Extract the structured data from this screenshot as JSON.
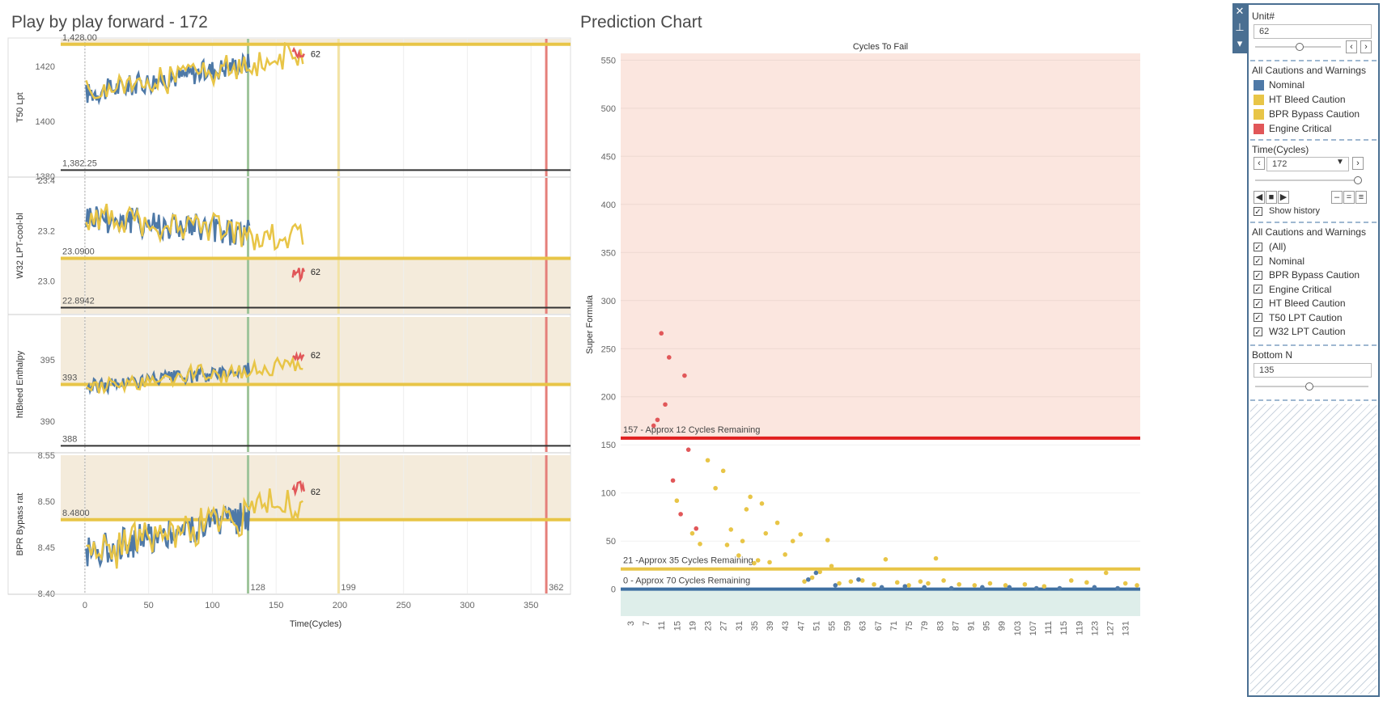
{
  "left_title": "Play by play forward - 172",
  "right_title": "Prediction Chart",
  "colors": {
    "nominal": "#4e79a7",
    "caution": "#e8c547",
    "critical": "#e15759",
    "band": "#f4ebdb",
    "crit_band": "#fbe6df",
    "low_band": "#deeeea",
    "green_line": "#9fc59b",
    "red_line": "#e57f7a",
    "pale_yellow": "#f3e3a4",
    "crit_rule": "#e02020",
    "nominal_rule": "#3e6fa1"
  },
  "left_chart": {
    "x_axis_title": "Time(Cycles)",
    "x_ticks": [
      "0",
      "50",
      "100",
      "150",
      "200",
      "250",
      "300",
      "350"
    ],
    "ref_lines": [
      {
        "x": 128,
        "label": "128",
        "color": "green"
      },
      {
        "x": 199,
        "label": "199",
        "color": "yellow"
      },
      {
        "x": 362,
        "label": "362",
        "color": "red"
      }
    ],
    "unit_label": "62",
    "panels": [
      {
        "ylabel": "T50 Lpt",
        "ymin": 1380,
        "ymax": 1430,
        "ticks": [
          "1380",
          "1400",
          "1420"
        ],
        "upper": 1428.0,
        "upper_label": "1,428.00",
        "lower": 1382.25,
        "lower_label": "1,382.25",
        "band": "above",
        "base": 1410,
        "amp": 4,
        "trend": 14,
        "end": 1425,
        "drop_line": false
      },
      {
        "ylabel": "W32 LPT-cool-bl",
        "ymin": 22.87,
        "ymax": 23.41,
        "ticks": [
          "23.0",
          "23.2",
          "23.4"
        ],
        "upper": 23.09,
        "upper_label": "23.0900",
        "lower": 22.8942,
        "lower_label": "22.8942",
        "band": "below",
        "base": 23.26,
        "amp": 0.06,
        "trend": -0.09,
        "end": 23.03,
        "drop_line": false
      },
      {
        "ylabel": "htBleed Enthalpy",
        "ymin": 387.5,
        "ymax": 398.5,
        "ticks": [
          "390",
          "395"
        ],
        "upper": 393,
        "upper_label": "393",
        "lower": 388,
        "lower_label": "388",
        "band": "above",
        "base": 392.8,
        "amp": 0.6,
        "trend": 1.7,
        "end": 395.2,
        "drop_line": true
      },
      {
        "ylabel": "BPR Bypass rat",
        "ymin": 8.4,
        "ymax": 8.55,
        "ticks": [
          "8.40",
          "8.45",
          "8.50",
          "8.55"
        ],
        "upper": 8.48,
        "upper_label": "8.4800",
        "lower": null,
        "lower_label": "",
        "band": "above",
        "base": 8.445,
        "amp": 0.018,
        "trend": 0.05,
        "end": 8.515,
        "drop_line": false
      }
    ]
  },
  "right_chart": {
    "top_title": "Cycles To Fail",
    "ylabel": "Super Formula",
    "ymin": -28,
    "ymax": 557,
    "y_ticks": [
      "0",
      "50",
      "100",
      "150",
      "200",
      "250",
      "300",
      "350",
      "400",
      "450",
      "500",
      "550"
    ],
    "x_ticks": [
      "3",
      "7",
      "11",
      "15",
      "19",
      "23",
      "27",
      "31",
      "35",
      "39",
      "43",
      "47",
      "51",
      "55",
      "59",
      "63",
      "67",
      "71",
      "75",
      "79",
      "83",
      "87",
      "91",
      "95",
      "99",
      "103",
      "107",
      "111",
      "115",
      "119",
      "123",
      "127",
      "131"
    ],
    "thresholds": [
      {
        "value": 157,
        "label": "157 - Approx 12 Cycles Remaining",
        "color": "critical_rule"
      },
      {
        "value": 21,
        "label": "21 -Approx 35 Cycles Remaining",
        "color": "caution"
      },
      {
        "value": 0,
        "label": "0 - Approx 70 Cycles Remaining",
        "color": "nominal_rule"
      }
    ],
    "points": [
      {
        "x": 10,
        "y": 176,
        "s": "critical"
      },
      {
        "x": 11,
        "y": 266,
        "s": "critical"
      },
      {
        "x": 12,
        "y": 192,
        "s": "critical"
      },
      {
        "x": 13,
        "y": 241,
        "s": "critical"
      },
      {
        "x": 14,
        "y": 113,
        "s": "critical"
      },
      {
        "x": 16,
        "y": 78,
        "s": "critical"
      },
      {
        "x": 17,
        "y": 222,
        "s": "critical"
      },
      {
        "x": 18,
        "y": 145,
        "s": "critical"
      },
      {
        "x": 20,
        "y": 63,
        "s": "critical"
      },
      {
        "x": 9,
        "y": 170,
        "s": "critical"
      },
      {
        "x": 15,
        "y": 92,
        "s": "caution"
      },
      {
        "x": 19,
        "y": 58,
        "s": "caution"
      },
      {
        "x": 21,
        "y": 47,
        "s": "caution"
      },
      {
        "x": 23,
        "y": 134,
        "s": "caution"
      },
      {
        "x": 25,
        "y": 105,
        "s": "caution"
      },
      {
        "x": 27,
        "y": 123,
        "s": "caution"
      },
      {
        "x": 28,
        "y": 46,
        "s": "caution"
      },
      {
        "x": 29,
        "y": 62,
        "s": "caution"
      },
      {
        "x": 31,
        "y": 35,
        "s": "caution"
      },
      {
        "x": 32,
        "y": 50,
        "s": "caution"
      },
      {
        "x": 33,
        "y": 83,
        "s": "caution"
      },
      {
        "x": 34,
        "y": 96,
        "s": "caution"
      },
      {
        "x": 35,
        "y": 27,
        "s": "caution"
      },
      {
        "x": 36,
        "y": 30,
        "s": "caution"
      },
      {
        "x": 37,
        "y": 89,
        "s": "caution"
      },
      {
        "x": 38,
        "y": 58,
        "s": "caution"
      },
      {
        "x": 39,
        "y": 28,
        "s": "caution"
      },
      {
        "x": 41,
        "y": 69,
        "s": "caution"
      },
      {
        "x": 43,
        "y": 36,
        "s": "caution"
      },
      {
        "x": 45,
        "y": 50,
        "s": "caution"
      },
      {
        "x": 47,
        "y": 57,
        "s": "caution"
      },
      {
        "x": 48,
        "y": 8,
        "s": "caution"
      },
      {
        "x": 50,
        "y": 12,
        "s": "caution"
      },
      {
        "x": 52,
        "y": 18,
        "s": "caution"
      },
      {
        "x": 54,
        "y": 51,
        "s": "caution"
      },
      {
        "x": 55,
        "y": 24,
        "s": "caution"
      },
      {
        "x": 57,
        "y": 6,
        "s": "caution"
      },
      {
        "x": 60,
        "y": 8,
        "s": "caution"
      },
      {
        "x": 63,
        "y": 9,
        "s": "caution"
      },
      {
        "x": 66,
        "y": 5,
        "s": "caution"
      },
      {
        "x": 69,
        "y": 31,
        "s": "caution"
      },
      {
        "x": 72,
        "y": 7,
        "s": "caution"
      },
      {
        "x": 75,
        "y": 4,
        "s": "caution"
      },
      {
        "x": 78,
        "y": 8,
        "s": "caution"
      },
      {
        "x": 80,
        "y": 6,
        "s": "caution"
      },
      {
        "x": 82,
        "y": 32,
        "s": "caution"
      },
      {
        "x": 84,
        "y": 9,
        "s": "caution"
      },
      {
        "x": 88,
        "y": 5,
        "s": "caution"
      },
      {
        "x": 92,
        "y": 4,
        "s": "caution"
      },
      {
        "x": 96,
        "y": 6,
        "s": "caution"
      },
      {
        "x": 100,
        "y": 4,
        "s": "caution"
      },
      {
        "x": 105,
        "y": 5,
        "s": "caution"
      },
      {
        "x": 110,
        "y": 3,
        "s": "caution"
      },
      {
        "x": 117,
        "y": 9,
        "s": "caution"
      },
      {
        "x": 121,
        "y": 7,
        "s": "caution"
      },
      {
        "x": 126,
        "y": 17,
        "s": "caution"
      },
      {
        "x": 131,
        "y": 6,
        "s": "caution"
      },
      {
        "x": 134,
        "y": 4,
        "s": "caution"
      },
      {
        "x": 49,
        "y": 10,
        "s": "nominal"
      },
      {
        "x": 51,
        "y": 17,
        "s": "nominal"
      },
      {
        "x": 56,
        "y": 4,
        "s": "nominal"
      },
      {
        "x": 62,
        "y": 10,
        "s": "nominal"
      },
      {
        "x": 68,
        "y": 2,
        "s": "nominal"
      },
      {
        "x": 74,
        "y": 3,
        "s": "nominal"
      },
      {
        "x": 79,
        "y": 2,
        "s": "nominal"
      },
      {
        "x": 86,
        "y": 1,
        "s": "nominal"
      },
      {
        "x": 94,
        "y": 2,
        "s": "nominal"
      },
      {
        "x": 101,
        "y": 2,
        "s": "nominal"
      },
      {
        "x": 108,
        "y": 1,
        "s": "nominal"
      },
      {
        "x": 114,
        "y": 1,
        "s": "nominal"
      },
      {
        "x": 123,
        "y": 2,
        "s": "nominal"
      },
      {
        "x": 129,
        "y": 1,
        "s": "nominal"
      }
    ]
  },
  "filter_panel": {
    "unit_title": "Unit#",
    "unit_value": "62",
    "legend_title": "All Cautions and Warnings",
    "legend": [
      {
        "label": "Nominal",
        "color": "#4e79a7"
      },
      {
        "label": "HT Bleed Caution",
        "color": "#e8c547"
      },
      {
        "label": "BPR Bypass Caution",
        "color": "#e8c547"
      },
      {
        "label": "Engine Critical",
        "color": "#e15759"
      }
    ],
    "time_title": "Time(Cycles)",
    "time_value": "172",
    "show_history": "Show history",
    "filter_title": "All Cautions and Warnings",
    "filters": [
      "(All)",
      "Nominal",
      "BPR Bypass Caution",
      "Engine Critical",
      "HT Bleed Caution",
      "T50 LPT Caution",
      "W32 LPT Caution"
    ],
    "bottom_title": "Bottom N",
    "bottom_value": "135"
  },
  "icons": {
    "close": "close-icon",
    "pin": "pin-icon",
    "menu": "dropdown-icon"
  }
}
